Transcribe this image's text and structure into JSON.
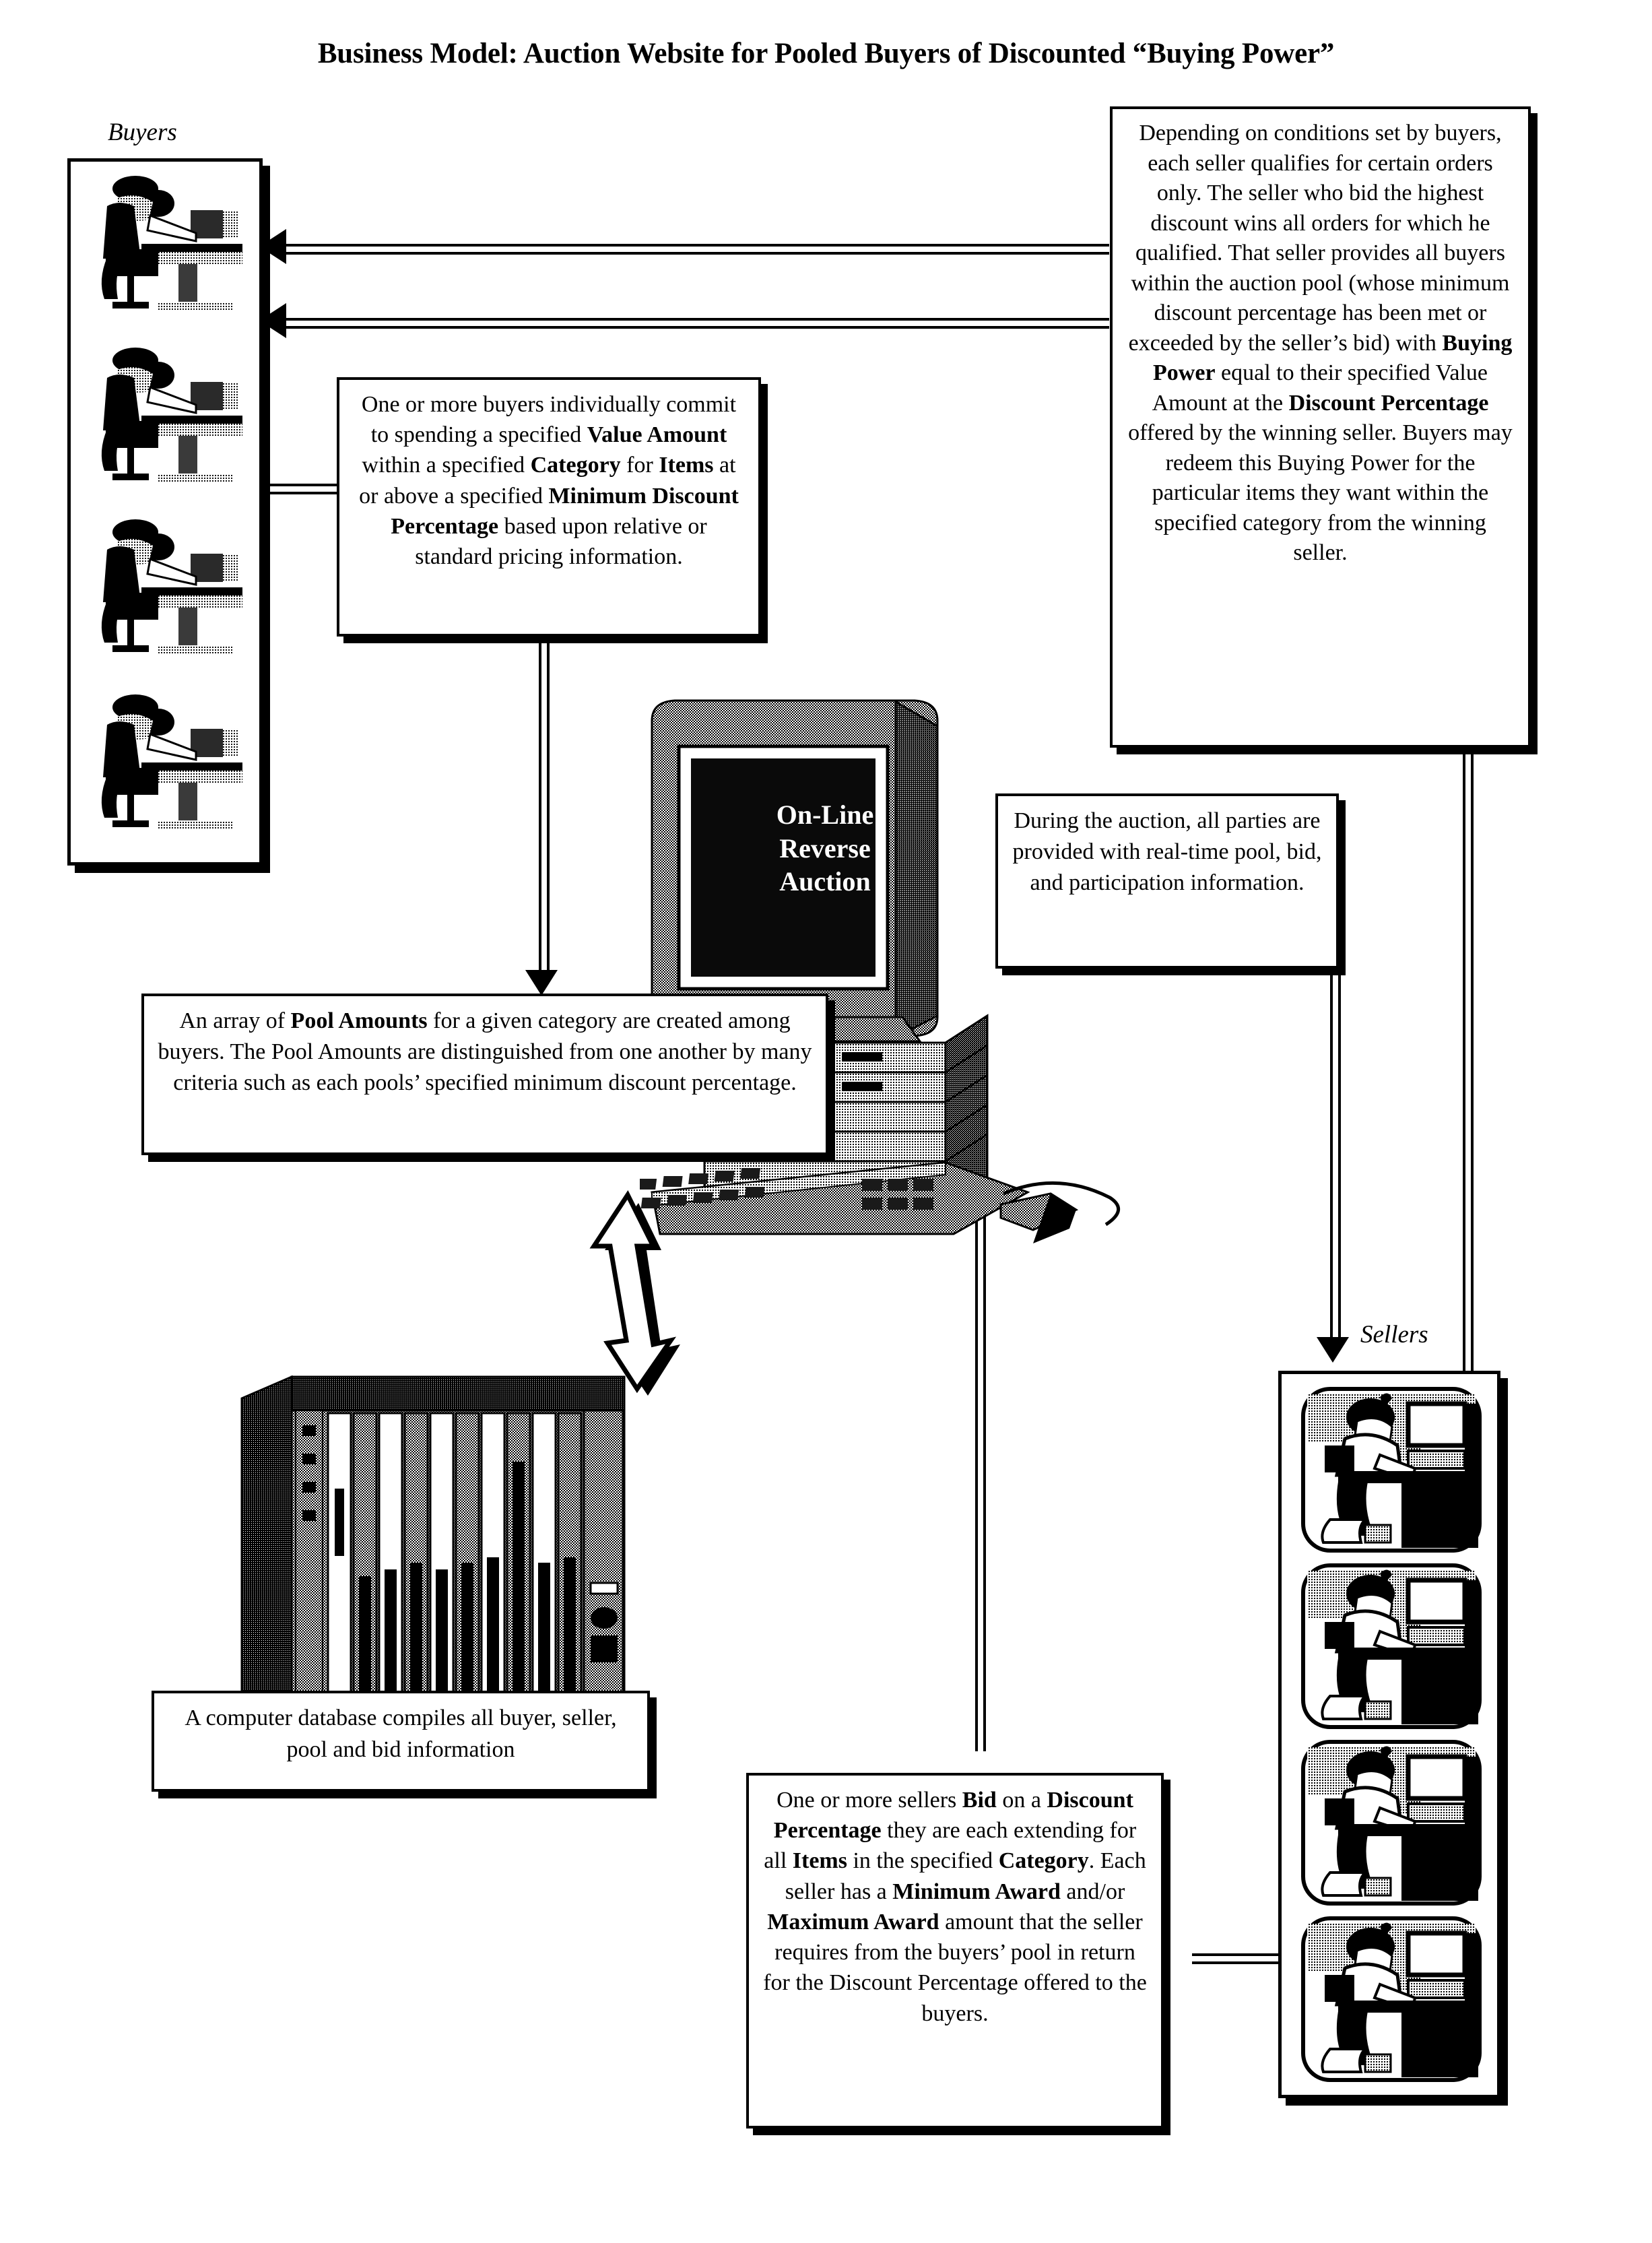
{
  "title": "Business Model: Auction Website for Pooled Buyers of Discounted “Buying Power”",
  "labels": {
    "buyers": "Buyers",
    "sellers": "Sellers"
  },
  "monitor": {
    "screen_line1": "On-Line",
    "screen_line2": "Reverse",
    "screen_line3": "Auction"
  },
  "boxes": {
    "buyers_commit": {
      "name": "buyers-commit-box",
      "segments": [
        {
          "text": "One or more buyers individually commit to spending a specified ",
          "bold": false
        },
        {
          "text": "Value Amount",
          "bold": true
        },
        {
          "text": " within a specified ",
          "bold": false
        },
        {
          "text": "Category",
          "bold": true
        },
        {
          "text": " for ",
          "bold": false
        },
        {
          "text": "Items",
          "bold": true
        },
        {
          "text": " at or above a specified ",
          "bold": false
        },
        {
          "text": "Minimum Discount Percentage",
          "bold": true
        },
        {
          "text": " based upon relative or standard pricing information.",
          "bold": false
        }
      ]
    },
    "seller_qualifies": {
      "name": "seller-qualifies-box",
      "segments": [
        {
          "text": "Depending on conditions set by buyers, each seller qualifies for certain orders only.  The seller who bid the highest discount wins all orders for which he qualified. That seller provides all buyers within the auction pool  (whose minimum discount percentage has been met or exceeded by the seller’s bid) with ",
          "bold": false
        },
        {
          "text": "Buying Power",
          "bold": true
        },
        {
          "text": " equal to their specified Value Amount at the ",
          "bold": false
        },
        {
          "text": "Discount Percentage",
          "bold": true
        },
        {
          "text": " offered by the winning seller. Buyers may redeem this Buying Power for the particular items they want within the specified category from the winning seller.",
          "bold": false
        }
      ]
    },
    "pool_amounts": {
      "name": "pool-amounts-box",
      "segments": [
        {
          "text": "An array of ",
          "bold": false
        },
        {
          "text": "Pool Amounts",
          "bold": true
        },
        {
          "text": " for a given category are created among buyers.  The Pool Amounts are distinguished from one another by many criteria such as each pools’ specified minimum discount percentage.",
          "bold": false
        }
      ]
    },
    "realtime_info": {
      "name": "realtime-info-box",
      "segments": [
        {
          "text": "During the auction, all parties are provided with real-time pool, bid, and participation information.",
          "bold": false
        }
      ]
    },
    "database": {
      "name": "database-box",
      "segments": [
        {
          "text": "A computer database compiles all buyer, seller, pool and bid information",
          "bold": false
        }
      ]
    },
    "sellers_bid": {
      "name": "sellers-bid-box",
      "segments": [
        {
          "text": "One or more sellers ",
          "bold": false
        },
        {
          "text": "Bid",
          "bold": true
        },
        {
          "text": " on a ",
          "bold": false
        },
        {
          "text": "Discount Percentage",
          "bold": true
        },
        {
          "text": " they are each extending for all ",
          "bold": false
        },
        {
          "text": "Items",
          "bold": true
        },
        {
          "text": " in the specified ",
          "bold": false
        },
        {
          "text": "Category",
          "bold": true
        },
        {
          "text": ".  Each seller has a ",
          "bold": false
        },
        {
          "text": "Minimum Award",
          "bold": true
        },
        {
          "text": " and/or ",
          "bold": false
        },
        {
          "text": "Maximum Award",
          "bold": true
        },
        {
          "text": " amount that the seller requires from the buyers’ pool in return for the Discount Percentage offered to the buyers.",
          "bold": false
        }
      ]
    }
  },
  "figures": {
    "buyer_count": 4,
    "seller_count": 4,
    "buyer_icon": "person-at-desk-icon",
    "seller_icon": "person-at-workstation-icon",
    "server_icon": "database-rack-icon",
    "pc_icon": "desktop-computer-icon"
  },
  "colors": {
    "ink": "#000000",
    "paper": "#ffffff",
    "screen": "#0a0a0a",
    "chassis_light": "#b4b4b4",
    "chassis_mid": "#8c8c8c",
    "chassis_dark": "#5a5a5a"
  }
}
